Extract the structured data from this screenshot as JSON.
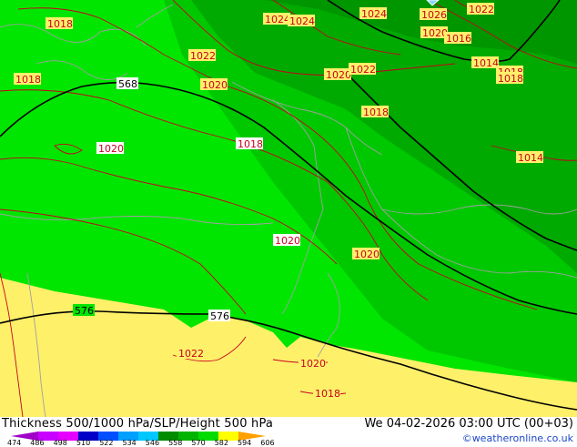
{
  "footer": {
    "title": "Thickness 500/1000 hPa/SLP/Height 500 hPa",
    "datetime": "We 04-02-2026 03:00 UTC (00+03)",
    "credit": "©weatheronline.co.uk"
  },
  "legend": {
    "ticks": [
      "474",
      "486",
      "498",
      "510",
      "522",
      "534",
      "546",
      "558",
      "570",
      "582",
      "594",
      "606"
    ],
    "colors": [
      "#a000c8",
      "#c800ff",
      "#e600ff",
      "#0000c8",
      "#0050ff",
      "#00a0ff",
      "#00c8ff",
      "#008c00",
      "#00b400",
      "#00dc00",
      "#ffff00",
      "#ffa000"
    ]
  },
  "map": {
    "colors": {
      "zone_yellow": "#fff06a",
      "zone_light_green": "#00e600",
      "zone_green": "#00c800",
      "zone_dark_green": "#00aa00",
      "zone_darker_green": "#009600",
      "slp_isobar": "#c8001e",
      "height_contour": "#000000",
      "coastline": "#a0a0a0"
    },
    "slp_labels": [
      "1018",
      "1018",
      "1022",
      "1020",
      "1020",
      "1018",
      "1024",
      "1024",
      "1020",
      "1022",
      "1024",
      "1026",
      "1022",
      "1020",
      "1016",
      "1014",
      "1018",
      "1018",
      "1018",
      "1014",
      "1020",
      "1020",
      "1022",
      "1020",
      "1018"
    ],
    "height_labels": [
      "568",
      "576",
      "576"
    ]
  }
}
